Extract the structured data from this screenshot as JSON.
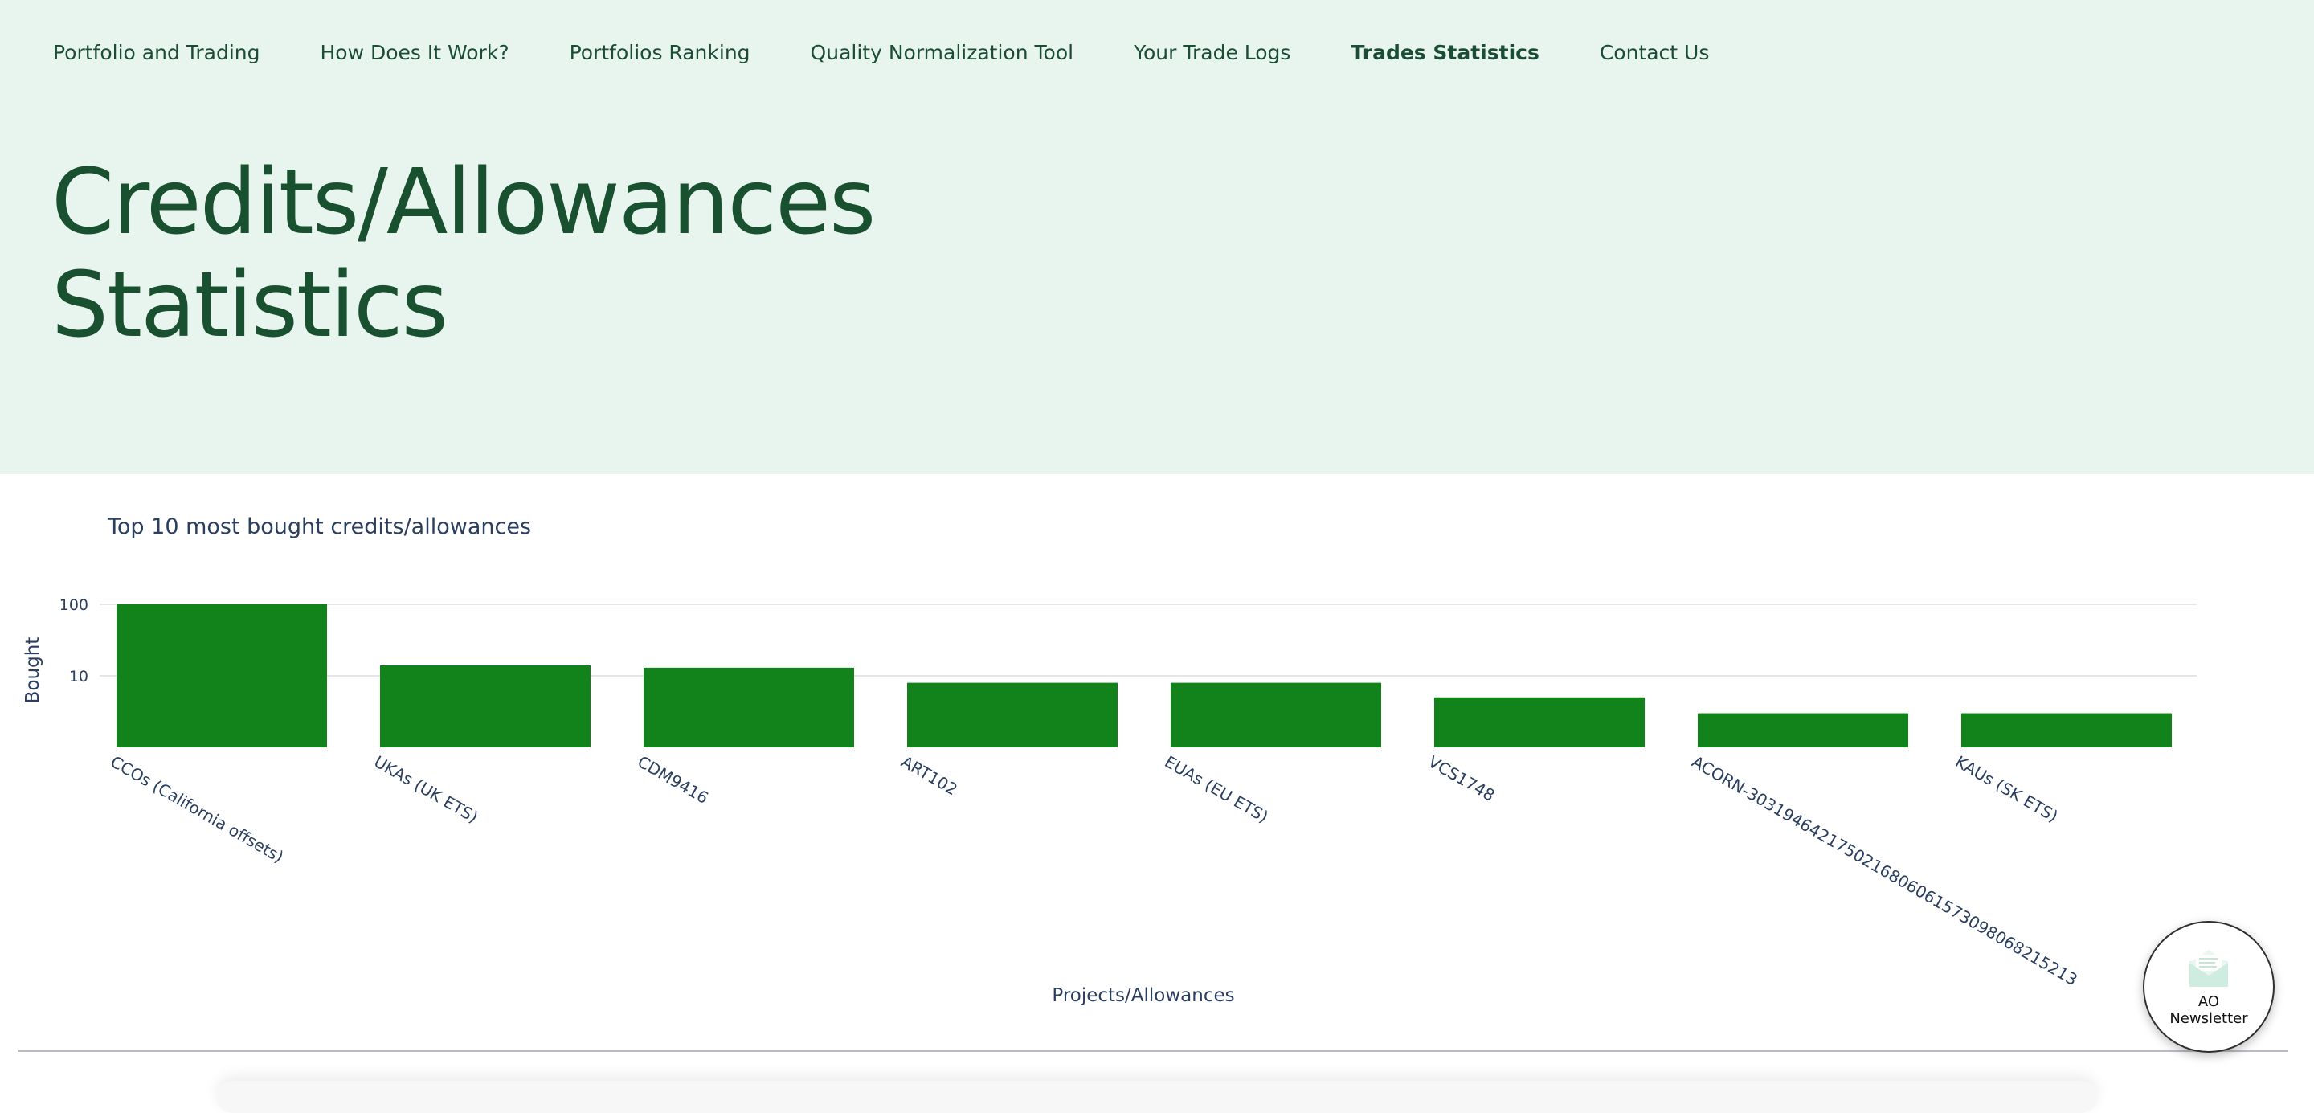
{
  "nav": {
    "items": [
      {
        "label": "Portfolio and Trading"
      },
      {
        "label": "How Does It Work?"
      },
      {
        "label": "Portfolios Ranking"
      },
      {
        "label": "Quality Normalization Tool"
      },
      {
        "label": "Your Trade Logs"
      },
      {
        "label": "Trades Statistics",
        "active": true
      },
      {
        "label": "Contact Us"
      }
    ]
  },
  "hero": {
    "title_line1": "Credits/Allowances",
    "title_line2": "Statistics"
  },
  "newsletter": {
    "line1": "AO",
    "line2": "Newsletter"
  },
  "colors": {
    "header_bg": "#e7f5ee",
    "brand_green": "#19502f",
    "bar_color": "#11831a",
    "axis_text": "#2a3f5f",
    "grid": "#e3e6ea"
  },
  "chart_data": {
    "type": "bar",
    "title": "Top 10 most bought credits/allowances",
    "xlabel": "Projects/Allowances",
    "ylabel": "Bought",
    "y_scale": "log",
    "ylim": [
      1,
      100
    ],
    "yticks": [
      10,
      100
    ],
    "ytick_labels": [
      "10",
      "100"
    ],
    "grid": true,
    "legend": "none",
    "categories": [
      "CCOs (California offsets)",
      "UKAs (UK ETS)",
      "CDM9416",
      "ART102",
      "EUAs (EU ETS)",
      "VCS1748",
      "ACORN-3031946421750216806061573098068215213",
      "KAUs (SK ETS)"
    ],
    "values": [
      100,
      14,
      13,
      8,
      8,
      5,
      3,
      3
    ]
  }
}
